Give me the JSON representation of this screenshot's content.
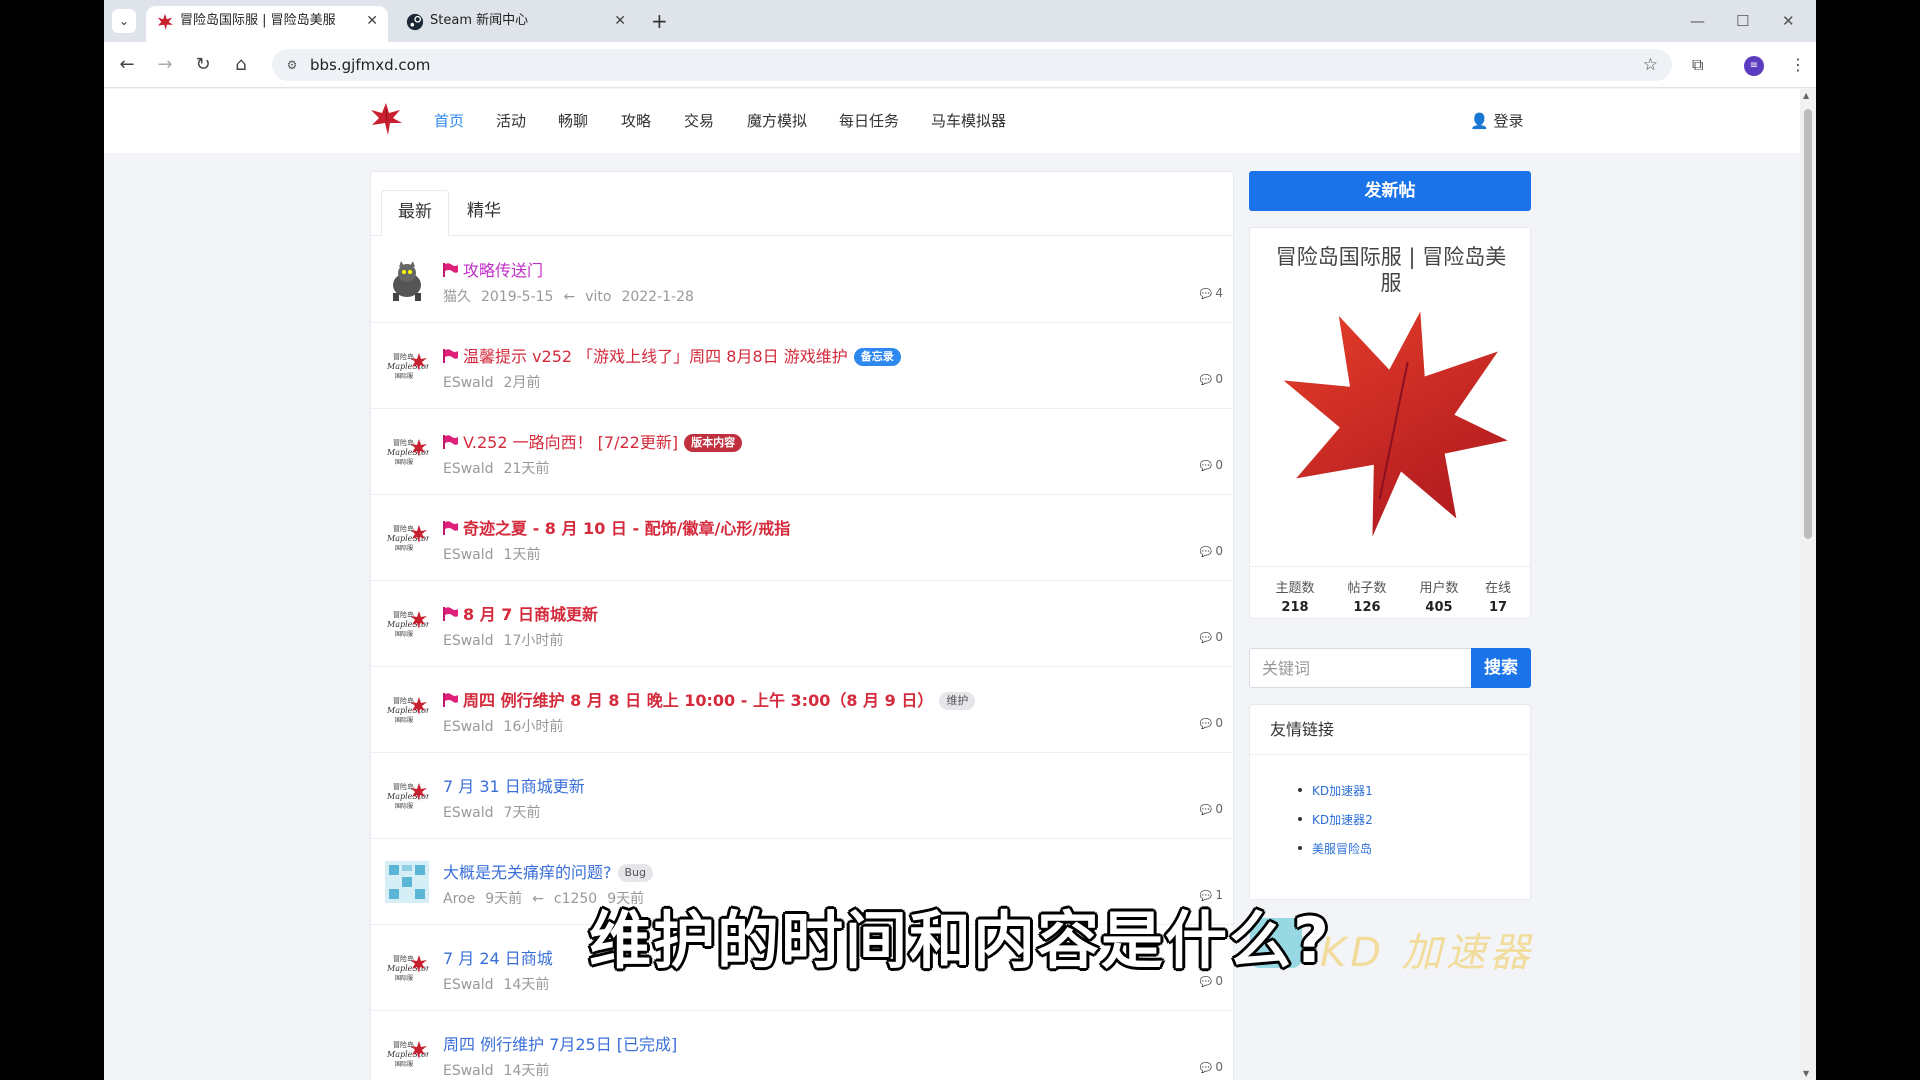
{
  "browser": {
    "tabs": [
      {
        "title": "冒险岛国际服 | 冒险岛美服",
        "active": true
      },
      {
        "title": "Steam 新闻中心",
        "active": false
      }
    ],
    "url": "bbs.gjfmxd.com"
  },
  "site": {
    "nav": [
      "首页",
      "活动",
      "畅聊",
      "攻略",
      "交易",
      "魔方模拟",
      "每日任务",
      "马车模拟器"
    ],
    "login": "登录",
    "list_tabs": [
      "最新",
      "精华"
    ]
  },
  "threads": [
    {
      "title": "攻略传送门",
      "pinned": true,
      "style": "magenta",
      "avatar": "cat-avatar",
      "author": "猫久",
      "date": "2019-5-15",
      "arrow": "←",
      "last_user": "vito",
      "last_date": "2022-1-28",
      "replies": "4"
    },
    {
      "title": "温馨提示 v252 「游戏上线了」周四 8月8日 游戏维护",
      "pinned": true,
      "style": "red",
      "badge": "备忘录",
      "badge_style": "blue",
      "avatar": "maplestory-avatar",
      "author": "ESwald",
      "date": "2月前",
      "replies": "0"
    },
    {
      "title": "V.252 一路向西！ [7/22更新]",
      "pinned": true,
      "style": "red",
      "badge": "版本内容",
      "badge_style": "red",
      "avatar": "maplestory-avatar",
      "author": "ESwald",
      "date": "21天前",
      "replies": "0"
    },
    {
      "title": "奇迹之夏 - 8 月 10 日 - 配饰/徽章/心形/戒指",
      "pinned": true,
      "style": "red-bold",
      "avatar": "maplestory-avatar",
      "author": "ESwald",
      "date": "1天前",
      "replies": "0"
    },
    {
      "title": "8 月 7 日商城更新",
      "pinned": true,
      "style": "red-bold",
      "avatar": "maplestory-avatar",
      "author": "ESwald",
      "date": "17小时前",
      "replies": "0"
    },
    {
      "title": "周四 例行维护 8 月 8 日 晚上 10:00 - 上午 3:00（8 月 9 日）",
      "pinned": true,
      "style": "red-bold",
      "badge": "维护",
      "badge_style": "gray",
      "avatar": "maplestory-avatar",
      "author": "ESwald",
      "date": "16小时前",
      "replies": "0"
    },
    {
      "title": "7 月 31 日商城更新",
      "pinned": false,
      "style": "blue",
      "avatar": "maplestory-avatar",
      "author": "ESwald",
      "date": "7天前",
      "replies": "0"
    },
    {
      "title": "大概是无关痛痒的问题?",
      "pinned": false,
      "style": "blue",
      "badge": "Bug",
      "badge_style": "gray",
      "avatar": "pixel-avatar",
      "author": "Aroe",
      "date": "9天前",
      "arrow": "←",
      "last_user": "c1250",
      "last_date": "9天前",
      "replies": "1"
    },
    {
      "title": "7 月 24 日商城",
      "pinned": false,
      "style": "blue",
      "avatar": "maplestory-avatar",
      "author": "ESwald",
      "date": "14天前",
      "replies": "0"
    },
    {
      "title": "周四 例行维护 7月25日 [已完成]",
      "pinned": false,
      "style": "blue",
      "avatar": "maplestory-avatar",
      "author": "ESwald",
      "date": "14天前",
      "replies": "0"
    }
  ],
  "sidebar": {
    "new_post": "发新帖",
    "site_name": "冒险岛国际服 | 冒险岛美服",
    "stats": [
      {
        "label": "主题数",
        "value": "218"
      },
      {
        "label": "帖子数",
        "value": "126"
      },
      {
        "label": "用户数",
        "value": "405"
      },
      {
        "label": "在线",
        "value": "17"
      }
    ],
    "search_placeholder": "关键词",
    "search_button": "搜索",
    "links_title": "友情链接",
    "links": [
      "KD加速器1",
      "KD加速器2",
      "美服冒险岛"
    ]
  },
  "overlay": {
    "subtitle": "维护的时间和内容是什么?",
    "watermark": "KD 加速器"
  },
  "colors": {
    "accent": "#1a73e8",
    "pinned_red": "#d42a3c",
    "link_blue": "#3a6fd8",
    "magenta": "#c02fc8"
  }
}
